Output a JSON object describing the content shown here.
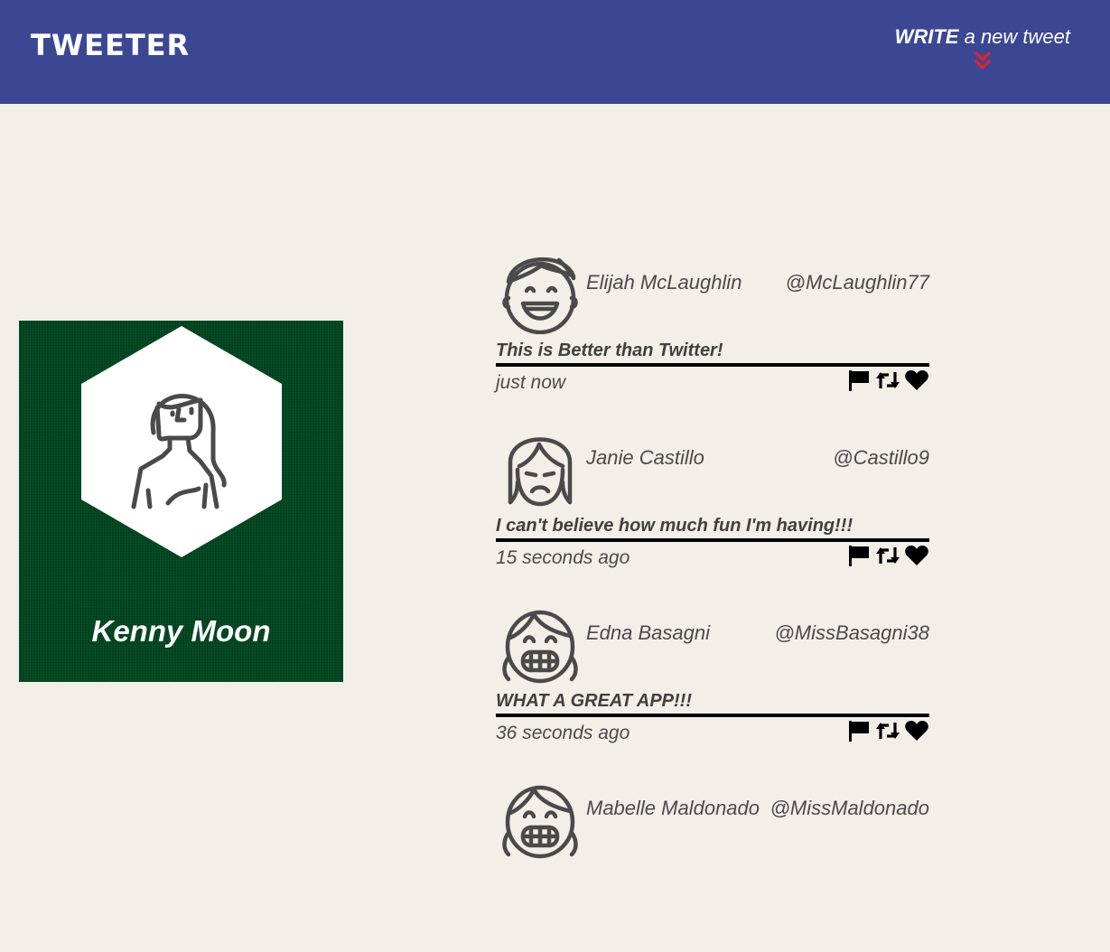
{
  "app": {
    "logo": "TWEETER"
  },
  "compose": {
    "bold": "WRITE",
    "rest": " a new tweet",
    "icon": "double-chevron-down-icon",
    "icon_color": "#e0252b"
  },
  "colors": {
    "nav": "#3c4794",
    "background": "#f1efe8",
    "profile": "#014520"
  },
  "profile": {
    "name": "Kenny Moon",
    "avatar_icon": "woman-avatar-icon"
  },
  "tweets": [
    {
      "name": "Elijah McLaughlin",
      "handle": "@McLaughlin77",
      "body": "This is Better than Twitter!",
      "time": "just now",
      "avatar_icon": "smiling-boy-avatar-icon"
    },
    {
      "name": "Janie Castillo",
      "handle": "@Castillo9",
      "body": "I can't believe how much fun I'm having!!!",
      "time": "15 seconds ago",
      "avatar_icon": "sad-girl-avatar-icon"
    },
    {
      "name": "Edna Basagni",
      "handle": "@MissBasagni38",
      "body": "WHAT A GREAT APP!!!",
      "time": "36 seconds ago",
      "avatar_icon": "grinning-girl-avatar-icon"
    },
    {
      "name": "Mabelle Maldonado",
      "handle": "@MissMaldonado",
      "body": "",
      "time": "",
      "avatar_icon": "grinning-girl-avatar-icon"
    }
  ],
  "tweet_actions": [
    "flag-icon",
    "retweet-icon",
    "heart-icon"
  ]
}
